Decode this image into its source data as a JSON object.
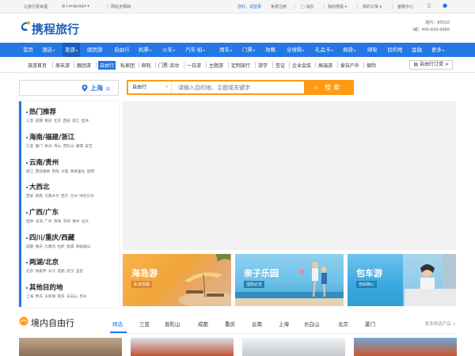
{
  "topbar": {
    "left_text": "让旅行更幸福",
    "language": "Language",
    "accessibility": "网站无障碍",
    "greeting": "您好，请登录",
    "register": "免费注册",
    "messages": "消息",
    "my_account": "我的携程",
    "my_orders": "我的订单",
    "service": "客服中心"
  },
  "header": {
    "logo_text": "携程旅行",
    "hotline_domestic": "境内：95010",
    "hotline_other": "（或）400-830-6666"
  },
  "mainnav": {
    "items": [
      "首页",
      "酒店",
      "旅游",
      "跟团游",
      "自由行",
      "机票",
      "火车",
      "汽车·船",
      "用车",
      "门票",
      "攻略",
      "全球购",
      "礼品卡",
      "商旅",
      "邮轮",
      "目的地",
      "金融",
      "更多"
    ]
  },
  "subnav": {
    "items": [
      "旅游首页",
      "周末游",
      "跟团游",
      "自由行",
      "私家团",
      "邮轮",
      "门票·活动",
      "一日游",
      "主题游",
      "定制旅行",
      "游学",
      "签证",
      "企业会奖",
      "高端游",
      "爱玩户外",
      "保险"
    ],
    "orders": "自由行订单 >"
  },
  "search": {
    "city": "上海",
    "city_suffix": "站",
    "category": "自由行",
    "placeholder": "请输入目的地、主题或关键字",
    "button": "搜索"
  },
  "categories": [
    {
      "title": "热门推荐",
      "links": "三亚 成都 重庆 北京 西安 丽江 桂林"
    },
    {
      "title": "海南/福建/浙江",
      "links": "三亚 厦门 杭州 舟山 普陀山 嵊泗 安吉"
    },
    {
      "title": "云南/贵州",
      "links": "丽江 西双版纳 贵阳 大理 香格里拉 昆明"
    },
    {
      "title": "大西北",
      "links": "西安 敦煌 乌鲁木齐 西宁 兰州 呼伦贝尔"
    },
    {
      "title": "广西/广东",
      "links": "桂林 北海 广州 珠海 深圳 惠州 汕头"
    },
    {
      "title": "四川/重庆/西藏",
      "links": "成都 重庆 九寨沟 拉萨 稻城 四姑娘山"
    },
    {
      "title": "两湖/北京",
      "links": "北京 张家界 长沙 恩施 武汉 宜昌"
    },
    {
      "title": "其他目的地",
      "links": "上海 青岛 天目湖 南京 长白山 苏州"
    }
  ],
  "promos": [
    {
      "title": "海岛游",
      "tag": "私享假期"
    },
    {
      "title": "亲子乐园",
      "tag": "溜娃必去"
    },
    {
      "title": "包车游",
      "tag": "自由随心"
    }
  ],
  "section": {
    "title": "境内自由行",
    "tabs": [
      "精选",
      "三亚",
      "普陀山",
      "成都",
      "重庆",
      "云南",
      "上海",
      "长白山",
      "北京",
      "厦门"
    ],
    "more": "更多精选产品 >"
  },
  "colors": {
    "brand_blue": "#2577e3",
    "search_orange": "#ff9a14",
    "promo_island": "#f0a43a",
    "promo_family": "#33a9cf",
    "promo_car": "#2f9ed3"
  }
}
